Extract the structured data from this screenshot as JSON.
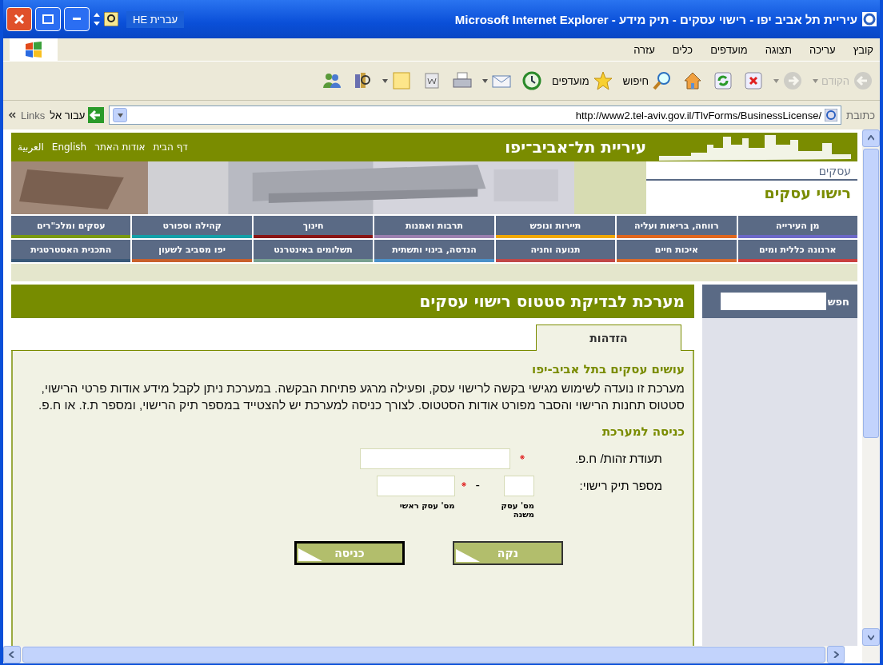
{
  "window": {
    "title": "עיריית תל אביב יפו - רישוי עסקים - תיק מידע - Microsoft Internet Explorer",
    "language": "HE עברית"
  },
  "menu": [
    "קובץ",
    "עריכה",
    "תצוגה",
    "מועדפים",
    "כלים",
    "עזרה"
  ],
  "toolbar": [
    {
      "kind": "back",
      "label": "הקודם",
      "disabled": true
    },
    {
      "kind": "forward",
      "disabled": true
    },
    {
      "kind": "stop"
    },
    {
      "kind": "refresh"
    },
    {
      "kind": "home"
    },
    {
      "kind": "search",
      "label": "חיפוש"
    },
    {
      "kind": "favorites",
      "label": "מועדפים"
    },
    {
      "kind": "history"
    },
    {
      "kind": "mail"
    },
    {
      "kind": "print"
    },
    {
      "kind": "word"
    },
    {
      "kind": "note"
    },
    {
      "kind": "research"
    },
    {
      "kind": "messenger"
    }
  ],
  "address_bar": {
    "label": "כתובת",
    "url": "http://www2.tel-aviv.gov.il/TlvForms/BusinessLicense/",
    "go": "עבור אל",
    "links": "Links"
  },
  "site": {
    "title": "עיריית תל־אביב־יפו",
    "top_links": [
      "דף הבית",
      "אודות האתר",
      "English",
      "العربية"
    ],
    "section": "עסקים",
    "subtitle": "רישוי עסקים",
    "nav": [
      [
        {
          "label": "מן העירייה",
          "color": "#6c68c8"
        },
        {
          "label": "רווחה, בריאות ועליה",
          "color": "#e0661e"
        },
        {
          "label": "תיירות ונופש",
          "color": "#f0a800"
        },
        {
          "label": "תרבות ואמנות",
          "color": "#9c80b0"
        },
        {
          "label": "חינוך",
          "color": "#8a1414"
        },
        {
          "label": "קהילה וספורט",
          "color": "#14a0a8"
        },
        {
          "label": "עסקים ומלכ\"רים",
          "color": "#7a9a10"
        }
      ],
      [
        {
          "label": "ארנונה כללית ומים",
          "color": "#c84040"
        },
        {
          "label": "איכות חיים",
          "color": "#d86a2c"
        },
        {
          "label": "תנועה וחניה",
          "color": "#c04848"
        },
        {
          "label": "הנדסה, בינוי ותשתית",
          "color": "#4a90c8"
        },
        {
          "label": "תשלומים באינטרנט",
          "color": "#78a090"
        },
        {
          "label": "יפו מסביב לשעון",
          "color": "#c8602c"
        },
        {
          "label": "התכנית האסטרטגית",
          "color": "#3a5878"
        }
      ]
    ]
  },
  "sidebar": {
    "search_label": "חפש"
  },
  "main": {
    "header": "מערכת לבדיקת סטטוס רישוי עסקים",
    "tabs": [
      {
        "label": "הזדהות",
        "selected": true
      }
    ],
    "heading": "עושים עסקים בתל אביב-יפו",
    "paragraph": "מערכת זו נועדה לשימוש מגישי בקשה לרישוי עסק, ופעילה מרגע פתיחת הבקשה. במערכת ניתן לקבל מידע אודות פרטי הרישוי, סטטוס תחנות הרישוי והסבר מפורט אודות הסטטוס. לצורך כניסה למערכת יש להצטייד במספר תיק הרישוי, ומספר ת.ז. או ח.פ.",
    "login_heading": "כניסה למערכת",
    "id_field": {
      "label": "תעודת זהות/ ח.פ.",
      "required": true
    },
    "license_field": {
      "label": "מספר תיק רישוי:",
      "separator": "-",
      "secondary_caption": "מס' עסק משנה",
      "main_caption": "מס' עסק ראשי",
      "required": true
    },
    "buttons": [
      {
        "label": "נקה",
        "focused": false
      },
      {
        "label": "כניסה",
        "focused": true
      }
    ]
  }
}
